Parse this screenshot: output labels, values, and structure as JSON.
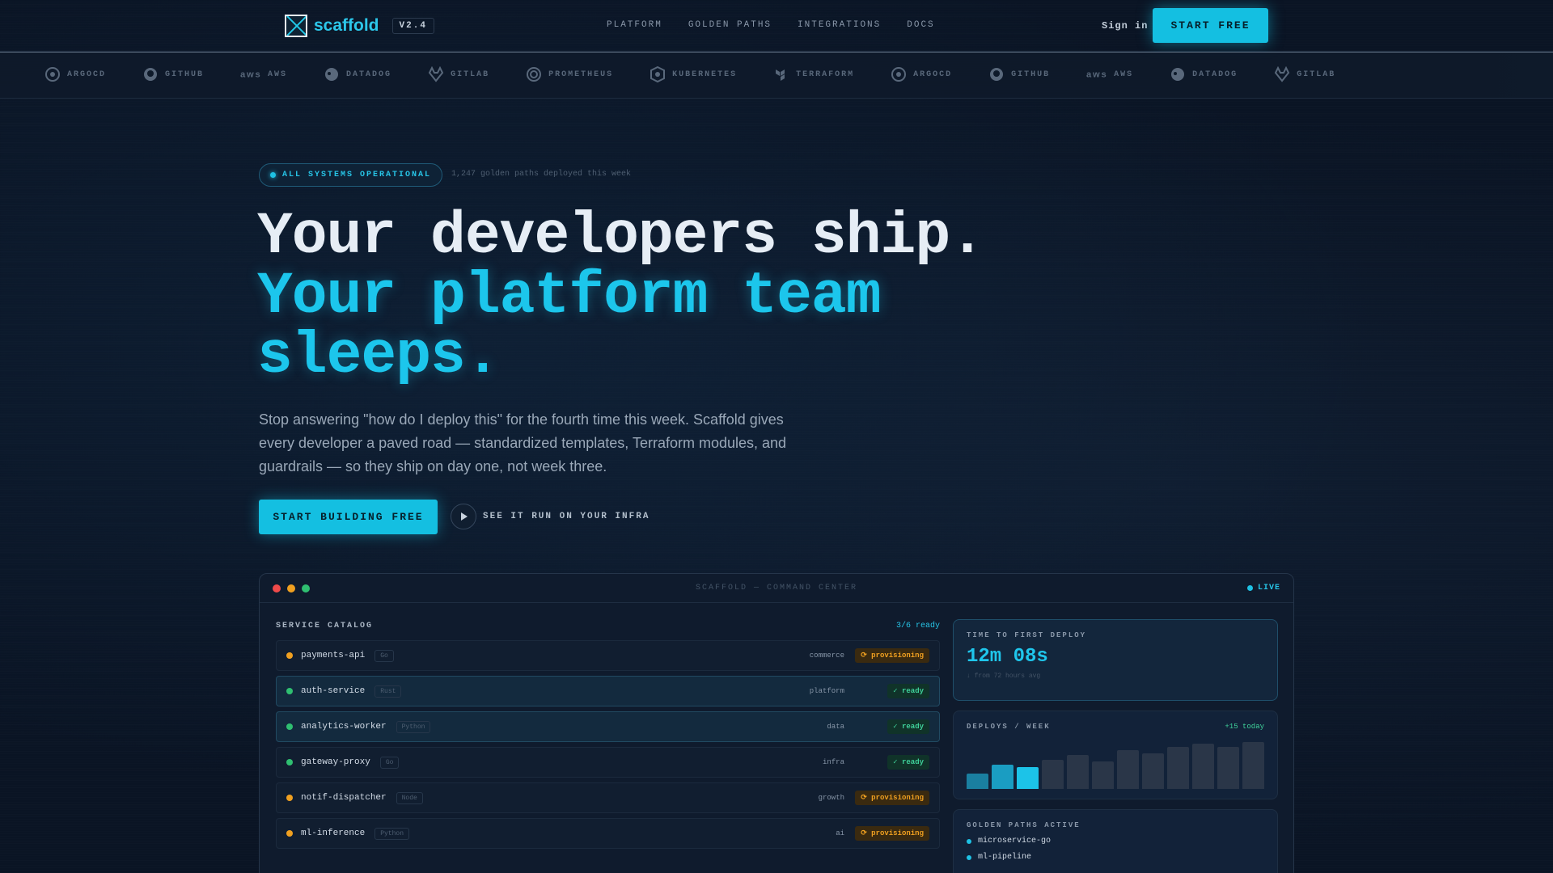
{
  "nav": {
    "logo_text": "scaffold",
    "version": "V2.4",
    "links": [
      "PLATFORM",
      "GOLDEN PATHS",
      "INTEGRATIONS",
      "DOCS"
    ],
    "sign_in": "Sign in",
    "start_free": "START FREE"
  },
  "strip": {
    "items": [
      {
        "label": "ARGOCD",
        "icon": "argocd-icon"
      },
      {
        "label": "GITHUB",
        "icon": "github-icon"
      },
      {
        "label": "AWS",
        "icon": "aws-icon"
      },
      {
        "label": "DATADOG",
        "icon": "datadog-icon"
      },
      {
        "label": "GITLAB",
        "icon": "gitlab-icon"
      },
      {
        "label": "PROMETHEUS",
        "icon": "prometheus-icon"
      },
      {
        "label": "KUBERNETES",
        "icon": "kubernetes-icon"
      },
      {
        "label": "TERRAFORM",
        "icon": "terraform-icon"
      },
      {
        "label": "ARGOCD",
        "icon": "argocd-icon"
      },
      {
        "label": "GITHUB",
        "icon": "github-icon"
      },
      {
        "label": "AWS",
        "icon": "aws-icon"
      },
      {
        "label": "DATADOG",
        "icon": "datadog-icon"
      },
      {
        "label": "GITLAB",
        "icon": "gitlab-icon"
      }
    ]
  },
  "hero": {
    "status": "ALL SYSTEMS OPERATIONAL",
    "status_sub": "1,247 golden paths deployed this week",
    "headline_1": "Your developers ship.",
    "headline_2": "Your platform team",
    "headline_3": "sleeps.",
    "lead": "Stop answering \"how do I deploy this\" for the fourth time this week. Scaffold gives every developer a paved road — standardized templates, Terraform modules, and guardrails — so they ship on day one, not week three.",
    "cta": "START BUILDING FREE",
    "watch": "SEE IT RUN ON YOUR INFRA"
  },
  "command_center": {
    "title": "SCAFFOLD — COMMAND CENTER",
    "live": "LIVE",
    "catalog": {
      "title": "SERVICE CATALOG",
      "count": "3/6 ready",
      "rows": [
        {
          "name": "payments-api",
          "lang": "Go",
          "team": "commerce",
          "status": "⟳ provisioning",
          "state": "prov",
          "highlight": false
        },
        {
          "name": "auth-service",
          "lang": "Rust",
          "team": "platform",
          "status": "✓ ready",
          "state": "ready",
          "highlight": true
        },
        {
          "name": "analytics-worker",
          "lang": "Python",
          "team": "data",
          "status": "✓ ready",
          "state": "ready",
          "highlight": true
        },
        {
          "name": "gateway-proxy",
          "lang": "Go",
          "team": "infra",
          "status": "✓ ready",
          "state": "ready",
          "highlight": false
        },
        {
          "name": "notif-dispatcher",
          "lang": "Node",
          "team": "growth",
          "status": "⟳ provisioning",
          "state": "prov",
          "highlight": false
        },
        {
          "name": "ml-inference",
          "lang": "Python",
          "team": "ai",
          "status": "⟳ provisioning",
          "state": "prov",
          "highlight": false
        }
      ]
    },
    "ttfd": {
      "label": "TIME TO FIRST DEPLOY",
      "value": "12m 08s",
      "sub": "↓ from 72 hours avg"
    },
    "deploys": {
      "label": "DEPLOYS / WEEK",
      "today": "+15 today",
      "bars": [
        0.32,
        0.52,
        0.47,
        0.62,
        0.72,
        0.58,
        0.83,
        0.76,
        0.9,
        0.97,
        0.89,
        1.0
      ],
      "bar_colors": [
        "#1a7fa0",
        "#1a9dc2",
        "#1cc3e8",
        "#2a3648",
        "#2a3648",
        "#2a3648",
        "#2a3648",
        "#2a3648",
        "#2a3648",
        "#2a3648",
        "#2a3648",
        "#2a3648"
      ]
    },
    "golden_paths": {
      "label": "GOLDEN PATHS ACTIVE",
      "items": [
        "microservice-go",
        "ml-pipeline"
      ]
    }
  }
}
